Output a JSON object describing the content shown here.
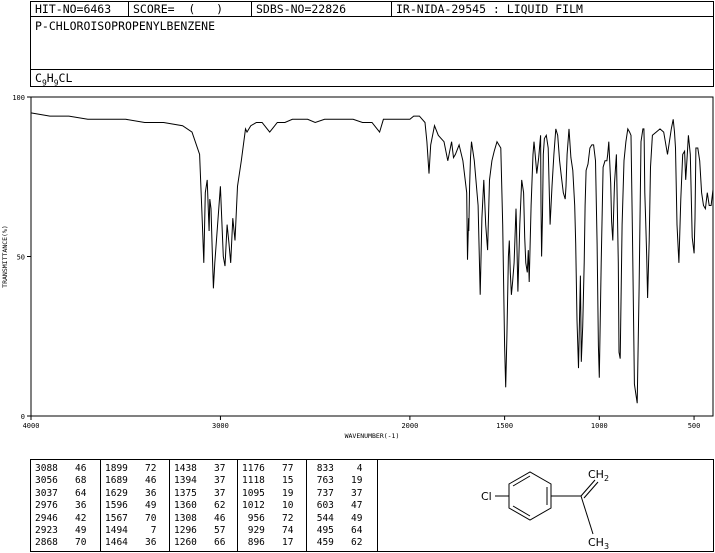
{
  "header": {
    "hit_no": "HIT-NO=6463",
    "score": "SCORE=  (   )",
    "sdbs_no": "SDBS-NO=22826",
    "ir_info": "IR-NIDA-29545 : LIQUID FILM"
  },
  "compound": {
    "name": "P-CHLOROISOPROPENYLBENZENE",
    "formula_parts": [
      "C",
      "9",
      "H",
      "9",
      "CL"
    ]
  },
  "chart_data": {
    "type": "line",
    "xlabel": "WAVENUMBER(-1)",
    "ylabel": "TRANSMITTANCE(%)",
    "xlim": [
      4000,
      400
    ],
    "ylim": [
      0,
      100
    ],
    "x_ticks": [
      4000,
      3000,
      2000,
      1500,
      1000,
      500
    ],
    "y_ticks": [
      0,
      50,
      100
    ],
    "grid": false,
    "series": [
      {
        "x": [
          4000,
          3900,
          3800,
          3700,
          3600,
          3500,
          3400,
          3300,
          3200,
          3150,
          3110,
          3095,
          3088,
          3080,
          3070,
          3060,
          3056,
          3050,
          3040,
          3037,
          3030,
          3015,
          3000,
          2985,
          2976,
          2965,
          2955,
          2946,
          2935,
          2923,
          2910,
          2890,
          2868,
          2860,
          2840,
          2810,
          2780,
          2740,
          2700,
          2660,
          2620,
          2580,
          2540,
          2500,
          2450,
          2400,
          2350,
          2300,
          2250,
          2200,
          2160,
          2140,
          2100,
          2050,
          2000,
          1980,
          1950,
          1920,
          1910,
          1899,
          1890,
          1870,
          1850,
          1820,
          1800,
          1790,
          1780,
          1770,
          1760,
          1740,
          1720,
          1700,
          1696,
          1690,
          1689,
          1685,
          1680,
          1675,
          1660,
          1640,
          1629,
          1620,
          1610,
          1600,
          1590,
          1580,
          1567,
          1555,
          1540,
          1520,
          1510,
          1500,
          1494,
          1488,
          1480,
          1475,
          1470,
          1464,
          1458,
          1450,
          1440,
          1438,
          1430,
          1420,
          1410,
          1400,
          1394,
          1388,
          1380,
          1375,
          1370,
          1360,
          1350,
          1345,
          1340,
          1330,
          1320,
          1310,
          1308,
          1305,
          1300,
          1296,
          1290,
          1280,
          1270,
          1260,
          1250,
          1240,
          1230,
          1220,
          1210,
          1200,
          1190,
          1180,
          1176,
          1170,
          1160,
          1150,
          1140,
          1130,
          1125,
          1118,
          1110,
          1100,
          1095,
          1088,
          1080,
          1075,
          1070,
          1060,
          1050,
          1040,
          1030,
          1020,
          1012,
          1005,
          1000,
          990,
          980,
          970,
          960,
          956,
          950,
          940,
          935,
          929,
          920,
          910,
          900,
          896,
          890,
          880,
          870,
          860,
          850,
          840,
          833,
          825,
          815,
          800,
          790,
          780,
          770,
          765,
          763,
          760,
          755,
          750,
          745,
          737,
          730,
          720,
          700,
          680,
          660,
          640,
          620,
          610,
          603,
          598,
          590,
          580,
          570,
          560,
          550,
          544,
          538,
          530,
          520,
          510,
          500,
          495,
          490,
          480,
          470,
          460,
          450,
          440,
          430,
          420,
          410,
          400
        ],
        "y": [
          95,
          94,
          94,
          93,
          93,
          93,
          92,
          92,
          91,
          89,
          82,
          60,
          48,
          70,
          74,
          58,
          68,
          65,
          45,
          40,
          48,
          60,
          72,
          50,
          47,
          60,
          54,
          48,
          62,
          55,
          72,
          80,
          90,
          89,
          91,
          92,
          92,
          89,
          92,
          92,
          93,
          93,
          93,
          92,
          93,
          93,
          93,
          93,
          92,
          92,
          89,
          93,
          93,
          93,
          93,
          94,
          94,
          92,
          86,
          76,
          85,
          91,
          88,
          86,
          80,
          83,
          86,
          81,
          82,
          85,
          80,
          70,
          49,
          62,
          58,
          72,
          81,
          86,
          80,
          66,
          38,
          62,
          74,
          60,
          52,
          74,
          80,
          83,
          86,
          84,
          60,
          22,
          9,
          25,
          50,
          55,
          45,
          38,
          42,
          48,
          65,
          61,
          39,
          60,
          74,
          70,
          56,
          48,
          45,
          52,
          42,
          66,
          82,
          86,
          83,
          76,
          81,
          88,
          66,
          50,
          63,
          82,
          87,
          88,
          84,
          60,
          72,
          82,
          90,
          88,
          80,
          75,
          70,
          68,
          72,
          82,
          90,
          81,
          77,
          66,
          54,
          30,
          15,
          44,
          17,
          28,
          48,
          66,
          77,
          79,
          84,
          85,
          85,
          80,
          54,
          22,
          12,
          48,
          78,
          80,
          80,
          82,
          86,
          73,
          61,
          55,
          73,
          82,
          48,
          20,
          18,
          60,
          80,
          86,
          90,
          89,
          88,
          56,
          10,
          4,
          40,
          86,
          90,
          90,
          86,
          70,
          61,
          50,
          37,
          55,
          78,
          88,
          89,
          90,
          89,
          82,
          90,
          93,
          89,
          84,
          60,
          48,
          68,
          82,
          83,
          74,
          80,
          88,
          82,
          56,
          51,
          62,
          84,
          84,
          80,
          70,
          66,
          65,
          70,
          66,
          66,
          71
        ]
      }
    ],
    "peak_table": [
      [
        3088,
        46
      ],
      [
        3056,
        68
      ],
      [
        3037,
        64
      ],
      [
        2976,
        36
      ],
      [
        2946,
        42
      ],
      [
        2923,
        49
      ],
      [
        2868,
        70
      ],
      [
        1899,
        72
      ],
      [
        1689,
        46
      ],
      [
        1629,
        36
      ],
      [
        1596,
        49
      ],
      [
        1567,
        70
      ],
      [
        1494,
        7
      ],
      [
        1464,
        36
      ],
      [
        1438,
        37
      ],
      [
        1394,
        37
      ],
      [
        1375,
        37
      ],
      [
        1360,
        62
      ],
      [
        1308,
        46
      ],
      [
        1296,
        57
      ],
      [
        1260,
        66
      ],
      [
        1176,
        77
      ],
      [
        1118,
        15
      ],
      [
        1095,
        19
      ],
      [
        1012,
        10
      ],
      [
        956,
        72
      ],
      [
        929,
        74
      ],
      [
        896,
        17
      ],
      [
        833,
        4
      ],
      [
        763,
        19
      ],
      [
        737,
        37
      ],
      [
        603,
        47
      ],
      [
        544,
        49
      ],
      [
        495,
        64
      ],
      [
        459,
        62
      ]
    ]
  },
  "structure": {
    "left_label": "Cl",
    "top_label": "CH2",
    "bottom_label": "CH3"
  }
}
